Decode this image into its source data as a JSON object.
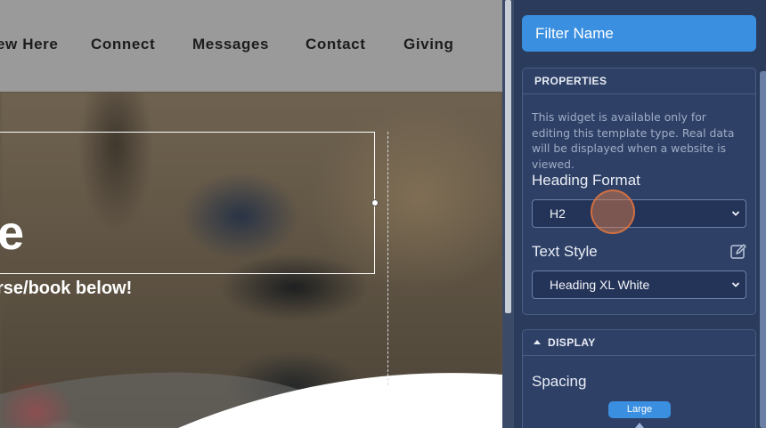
{
  "nav": {
    "items": [
      "ew Here",
      "Connect",
      "Messages",
      "Contact",
      "Giving"
    ]
  },
  "hero": {
    "heading_fragment": "e",
    "subheading": "rse/book below!"
  },
  "panel": {
    "filter_name": "Filter Name",
    "properties": {
      "title": "PROPERTIES",
      "note": "This widget is available only for editing this template type. Real data will be displayed when a website is viewed.",
      "heading_format_label": "Heading Format",
      "heading_format_value": "H2",
      "text_style_label": "Text Style",
      "text_style_value": "Heading XL White"
    },
    "display": {
      "title": "DISPLAY",
      "spacing_label": "Spacing",
      "spacing_value": "Large"
    }
  },
  "colors": {
    "accent": "#3a8fe0",
    "panel_bg": "#2a3b5c",
    "nav_bg": "#9a9a9a"
  }
}
